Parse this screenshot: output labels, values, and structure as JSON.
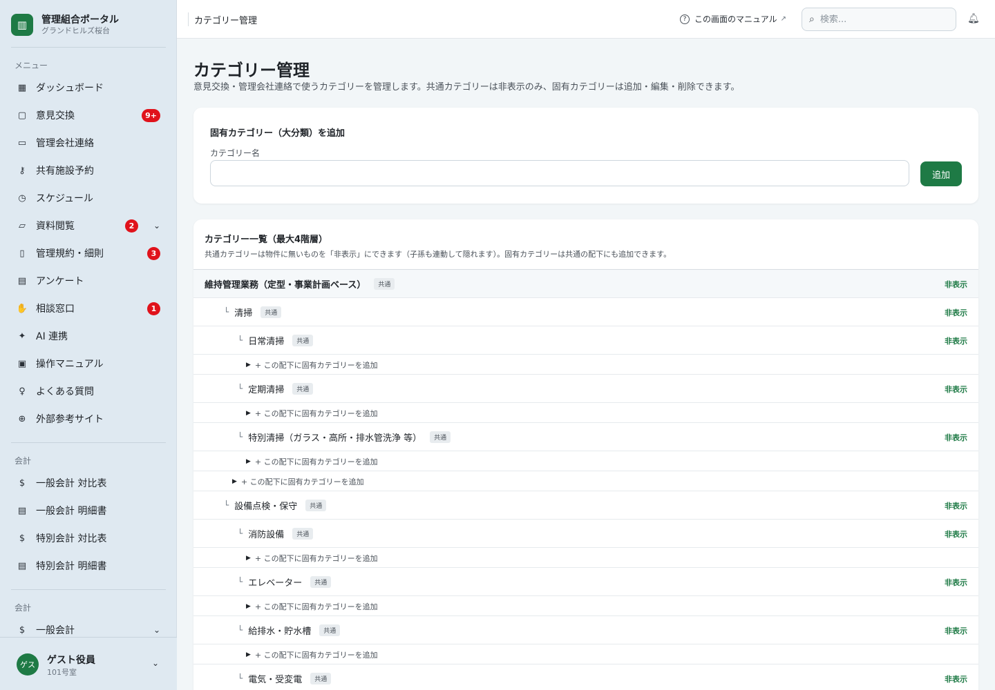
{
  "brand": {
    "title": "管理組合ポータル",
    "subtitle": "グランドヒルズ桜台",
    "logo_icon": "building-icon"
  },
  "sidebar": {
    "menu_heading": "メニュー",
    "items": [
      {
        "label": "ダッシュボード",
        "icon": "dashboard-icon",
        "glyph": "▦"
      },
      {
        "label": "意見交換",
        "icon": "chat-icon",
        "glyph": "▢",
        "badge": "9+"
      },
      {
        "label": "管理会社連絡",
        "icon": "briefcase-icon",
        "glyph": "▭"
      },
      {
        "label": "共有施設予約",
        "icon": "key-icon",
        "glyph": "⚷"
      },
      {
        "label": "スケジュール",
        "icon": "calendar-clock-icon",
        "glyph": "◷"
      },
      {
        "label": "資料閲覧",
        "icon": "folder-icon",
        "glyph": "▱",
        "badge": "2",
        "expand": "⌄"
      },
      {
        "label": "管理規約・細則",
        "icon": "book-icon",
        "glyph": "▯",
        "badge": "3"
      },
      {
        "label": "アンケート",
        "icon": "clipboard-icon",
        "glyph": "▤"
      },
      {
        "label": "相談窓口",
        "icon": "hand-icon",
        "glyph": "✋",
        "badge": "1"
      },
      {
        "label": "AI 連携",
        "icon": "sparkle-icon",
        "glyph": "✦"
      },
      {
        "label": "操作マニュアル",
        "icon": "manual-icon",
        "glyph": "▣"
      },
      {
        "label": "よくある質問",
        "icon": "lightbulb-icon",
        "glyph": "♀"
      },
      {
        "label": "外部参考サイト",
        "icon": "globe-icon",
        "glyph": "⊕"
      }
    ],
    "accounting_heading_1": "会計",
    "accounting_items": [
      {
        "label": "一般会計 対比表",
        "icon": "dollar-icon",
        "glyph": "$"
      },
      {
        "label": "一般会計 明細書",
        "icon": "document-icon",
        "glyph": "▤"
      },
      {
        "label": "特別会計 対比表",
        "icon": "dollar-icon",
        "glyph": "$"
      },
      {
        "label": "特別会計 明細書",
        "icon": "document-icon",
        "glyph": "▤"
      }
    ],
    "accounting_heading_2": "会計",
    "accounting_group": {
      "label": "一般会計",
      "icon": "dollar-icon",
      "glyph": "$",
      "expand": "⌄"
    }
  },
  "user": {
    "avatar_text": "ゲス",
    "name": "ゲスト役員",
    "room": "101号室"
  },
  "header": {
    "title": "カテゴリー管理",
    "manual_link": "この画面のマニュアル",
    "search_placeholder": "検索..."
  },
  "page": {
    "title": "カテゴリー管理",
    "description": "意見交換・管理会社連絡で使うカテゴリーを管理します。共通カテゴリーは非表示のみ、固有カテゴリーは追加・編集・削除できます。"
  },
  "add_form": {
    "heading": "固有カテゴリー（大分類）を追加",
    "field_label": "カテゴリー名",
    "field_value": "",
    "button": "追加"
  },
  "list": {
    "heading": "カテゴリー一覧（最大4階層）",
    "note": "共通カテゴリーは物件に無いものを「非表示」にできます（子孫も連動して隠れます）。固有カテゴリーは共通の配下にも追加できます。",
    "tag_common": "共通",
    "hide_label": "非表示",
    "add_under_label": "+ この配下に固有カテゴリーを追加",
    "rows": [
      {
        "kind": "cat",
        "level": 0,
        "name": "維持管理業務（定型・事業計画ベース）"
      },
      {
        "kind": "cat",
        "level": 1,
        "name": "清掃"
      },
      {
        "kind": "cat",
        "level": 2,
        "name": "日常清掃"
      },
      {
        "kind": "add",
        "level": 3
      },
      {
        "kind": "cat",
        "level": 2,
        "name": "定期清掃"
      },
      {
        "kind": "add",
        "level": 3
      },
      {
        "kind": "cat",
        "level": 2,
        "name": "特別清掃（ガラス・高所・排水管洗浄 等）"
      },
      {
        "kind": "add",
        "level": 3
      },
      {
        "kind": "add",
        "level": 2
      },
      {
        "kind": "cat",
        "level": 1,
        "name": "設備点検・保守"
      },
      {
        "kind": "cat",
        "level": 2,
        "name": "消防設備"
      },
      {
        "kind": "add",
        "level": 3
      },
      {
        "kind": "cat",
        "level": 2,
        "name": "エレベーター"
      },
      {
        "kind": "add",
        "level": 3
      },
      {
        "kind": "cat",
        "level": 2,
        "name": "給排水・貯水槽"
      },
      {
        "kind": "add",
        "level": 3
      },
      {
        "kind": "cat",
        "level": 2,
        "name": "電気・受変電"
      }
    ]
  },
  "colors": {
    "accent": "#1e7a45",
    "badge": "#e0121b",
    "sidebar_bg": "#dfe9f1"
  }
}
